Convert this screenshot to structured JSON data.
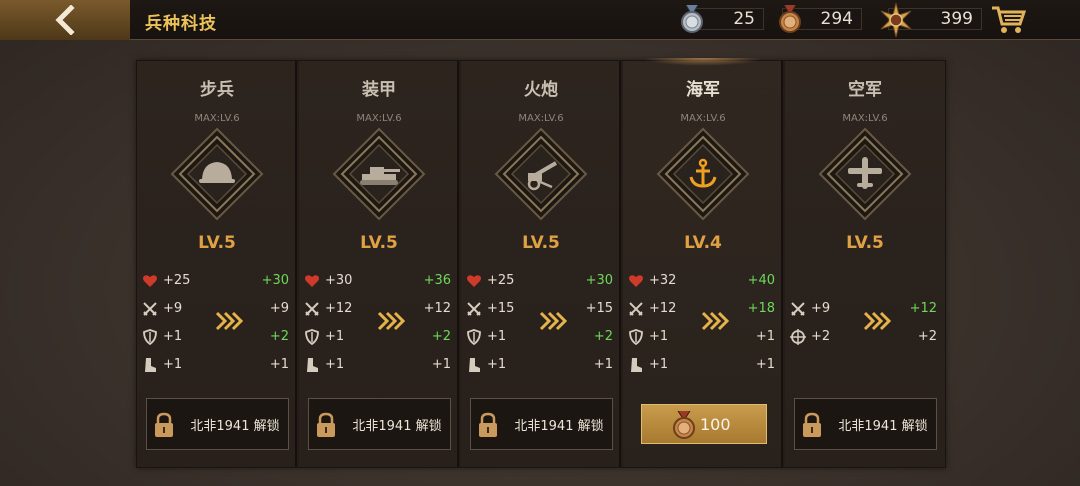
{
  "header": {
    "title": "兵种科技",
    "resources": [
      {
        "icon": "silver-medal-icon",
        "value": "25"
      },
      {
        "icon": "bronze-medal-icon",
        "value": "294"
      },
      {
        "icon": "star-badge-icon",
        "value": "399"
      }
    ]
  },
  "colors": {
    "accent": "#e0a144",
    "title": "#ecc35a",
    "up": "#6ed85a"
  },
  "units": [
    {
      "name": "步兵",
      "max": "MAX:LV.6",
      "level": "LV.5",
      "emblem": "helmet-icon",
      "stats": [
        {
          "icon": "heart-icon",
          "cur": "+25",
          "next": "+30",
          "up": true
        },
        {
          "icon": "swords-icon",
          "cur": "+9",
          "next": "+9",
          "up": false
        },
        {
          "icon": "shield-icon",
          "cur": "+1",
          "next": "+2",
          "up": true
        },
        {
          "icon": "boot-icon",
          "cur": "+1",
          "next": "+1",
          "up": false
        }
      ],
      "action": {
        "type": "locked",
        "label": "北非1941 解锁"
      }
    },
    {
      "name": "装甲",
      "max": "MAX:LV.6",
      "level": "LV.5",
      "emblem": "tank-icon",
      "stats": [
        {
          "icon": "heart-icon",
          "cur": "+30",
          "next": "+36",
          "up": true
        },
        {
          "icon": "swords-icon",
          "cur": "+12",
          "next": "+12",
          "up": false
        },
        {
          "icon": "shield-icon",
          "cur": "+1",
          "next": "+2",
          "up": true
        },
        {
          "icon": "boot-icon",
          "cur": "+1",
          "next": "+1",
          "up": false
        }
      ],
      "action": {
        "type": "locked",
        "label": "北非1941 解锁"
      }
    },
    {
      "name": "火炮",
      "max": "MAX:LV.6",
      "level": "LV.5",
      "emblem": "artillery-icon",
      "stats": [
        {
          "icon": "heart-icon",
          "cur": "+25",
          "next": "+30",
          "up": true
        },
        {
          "icon": "swords-icon",
          "cur": "+15",
          "next": "+15",
          "up": false
        },
        {
          "icon": "shield-icon",
          "cur": "+1",
          "next": "+2",
          "up": true
        },
        {
          "icon": "boot-icon",
          "cur": "+1",
          "next": "+1",
          "up": false
        }
      ],
      "action": {
        "type": "locked",
        "label": "北非1941 解锁"
      }
    },
    {
      "name": "海军",
      "max": "MAX:LV.6",
      "level": "LV.4",
      "emblem": "anchor-icon",
      "stats": [
        {
          "icon": "heart-icon",
          "cur": "+32",
          "next": "+40",
          "up": true
        },
        {
          "icon": "swords-icon",
          "cur": "+12",
          "next": "+18",
          "up": true
        },
        {
          "icon": "shield-icon",
          "cur": "+1",
          "next": "+1",
          "up": false
        },
        {
          "icon": "boot-icon",
          "cur": "+1",
          "next": "+1",
          "up": false
        }
      ],
      "action": {
        "type": "buy",
        "label": "100"
      }
    },
    {
      "name": "空军",
      "max": "MAX:LV.6",
      "level": "LV.5",
      "emblem": "plane-icon",
      "stats": [
        {
          "icon": "swords-icon",
          "cur": "+9",
          "next": "+12",
          "up": true
        },
        {
          "icon": "crosshair-icon",
          "cur": "+2",
          "next": "+2",
          "up": false
        }
      ],
      "action": {
        "type": "locked",
        "label": "北非1941 解锁"
      }
    }
  ]
}
